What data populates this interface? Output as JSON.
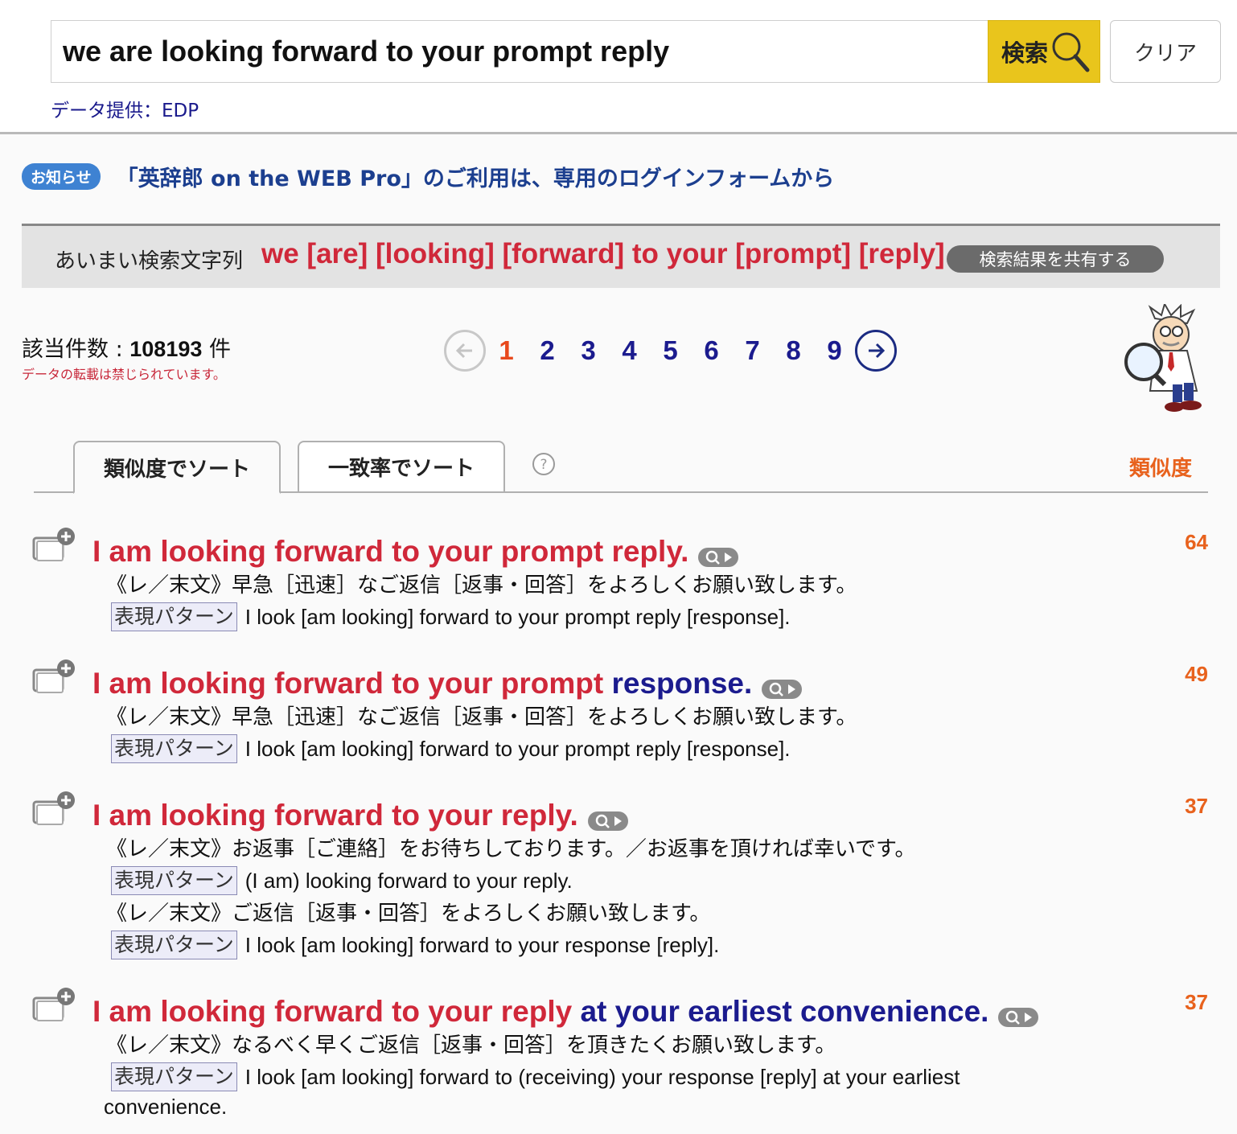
{
  "search": {
    "query": "we are looking forward to your prompt reply",
    "button_label": "検索",
    "clear_label": "クリア",
    "data_source": "データ提供：EDP"
  },
  "notice": {
    "badge": "お知らせ",
    "link_text": "「英辞郎 on the WEB Pro」のご利用は、専用のログインフォームから"
  },
  "fuzzy": {
    "label": "あいまい検索文字列",
    "query": "we [are] [looking] [forward] to your [prompt] [reply]",
    "share_label": "検索結果を共有する"
  },
  "results": {
    "count_prefix": "該当件数 : ",
    "count": "108193",
    "count_suffix": " 件",
    "copyright_note": "データの転載は禁じられています。"
  },
  "pagination": {
    "pages": [
      "1",
      "2",
      "3",
      "4",
      "5",
      "6",
      "7",
      "8",
      "9"
    ],
    "current": "1"
  },
  "sort": {
    "tab_similarity": "類似度でソート",
    "tab_match_rate": "一致率でソート",
    "active_tab": "similarity",
    "column_label": "類似度"
  },
  "entries": [
    {
      "head_red": "I am looking forward to your prompt reply.",
      "head_blue": "",
      "head_tail": "",
      "score": "64",
      "lines": [
        {
          "type": "ja",
          "text": "《レ／末文》早急［迅速］なご返信［返事・回答］をよろしくお願い致します。"
        },
        {
          "type": "pattern",
          "tag": "表現パターン",
          "text": "I look [am looking] forward to your prompt reply [response]."
        }
      ]
    },
    {
      "head_red": "I am looking forward to your prompt ",
      "head_blue": "response.",
      "head_tail": "",
      "score": "49",
      "lines": [
        {
          "type": "ja",
          "text": "《レ／末文》早急［迅速］なご返信［返事・回答］をよろしくお願い致します。"
        },
        {
          "type": "pattern",
          "tag": "表現パターン",
          "text": "I look [am looking] forward to your prompt reply [response]."
        }
      ]
    },
    {
      "head_red": "I am looking forward to your reply.",
      "head_blue": "",
      "head_tail": "",
      "score": "37",
      "lines": [
        {
          "type": "ja",
          "text": "《レ／末文》お返事［ご連絡］をお待ちしております。／お返事を頂ければ幸いです。"
        },
        {
          "type": "pattern",
          "tag": "表現パターン",
          "text": "(I am) looking forward to your reply."
        },
        {
          "type": "ja",
          "text": "《レ／末文》ご返信［返事・回答］をよろしくお願い致します。"
        },
        {
          "type": "pattern",
          "tag": "表現パターン",
          "text": "I look [am looking] forward to your response [reply]."
        }
      ]
    },
    {
      "head_red": "I am looking forward to your reply ",
      "head_blue": "at your earliest convenience.",
      "head_tail": "",
      "score": "37",
      "lines": [
        {
          "type": "ja",
          "text": "《レ／末文》なるべく早くご返信［返事・回答］を頂きたくお願い致します。"
        },
        {
          "type": "pattern",
          "tag": "表現パターン",
          "text": "I look [am looking] forward to (receiving) your response [reply] at your earliest"
        },
        {
          "type": "wrap",
          "text": "convenience."
        }
      ]
    }
  ],
  "colors": {
    "accent_yellow": "#e9c51c",
    "highlight_red": "#d0283a",
    "highlight_blue": "#1b1b8e",
    "score_orange": "#e8621d",
    "notice_badge": "#3e82d2"
  },
  "icons": {
    "search": "magnifier-icon",
    "prev": "arrow-left-icon",
    "next": "arrow-right-icon",
    "help": "question-icon",
    "entry": "add-to-wordbook-icon",
    "speak": "speak-search-icon",
    "mascot": "professor-magnifier-mascot"
  }
}
